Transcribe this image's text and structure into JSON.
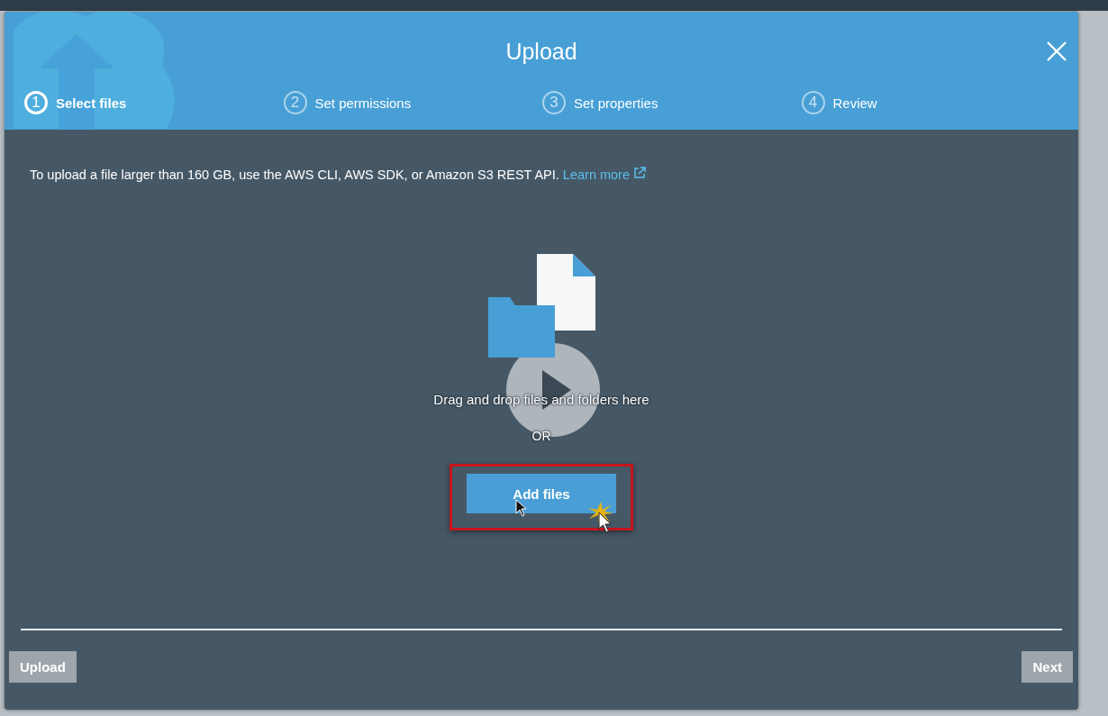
{
  "dialog": {
    "title": "Upload"
  },
  "steps": [
    {
      "number": "1",
      "label": "Select files",
      "selected": true
    },
    {
      "number": "2",
      "label": "Set permissions",
      "selected": false
    },
    {
      "number": "3",
      "label": "Set properties",
      "selected": false
    },
    {
      "number": "4",
      "label": "Review",
      "selected": false
    }
  ],
  "notice": {
    "text": "To upload a file larger than 160 GB, use the AWS CLI, AWS SDK, or Amazon S3 REST API.",
    "link": "Learn more"
  },
  "drop_zone": {
    "hint": "Drag and drop files and folders here",
    "separator": "OR",
    "button": "Add files",
    "highlighted": true
  },
  "footer": {
    "buttons": [
      {
        "label": "Upload",
        "disabled": true
      },
      {
        "label": "Next",
        "disabled": true
      }
    ]
  }
}
